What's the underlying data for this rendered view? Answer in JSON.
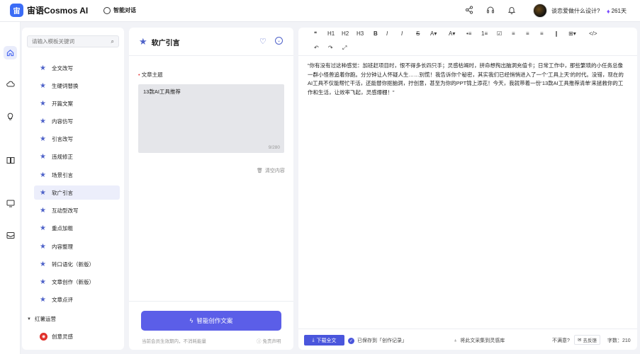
{
  "app": {
    "logo_glyph": "宙",
    "name": "宙语Cosmos AI"
  },
  "header": {
    "nav_chat": "智能对话",
    "icons": [
      "share-icon",
      "headset-icon",
      "bell-icon"
    ],
    "user_name": "谈恋爱做什么设计?",
    "vip_days": "261天"
  },
  "rail": {
    "items": [
      "home-icon",
      "cloud-icon",
      "bulb-icon",
      "book-icon",
      "monitor-icon",
      "mail-icon"
    ],
    "active_index": 0
  },
  "templates": {
    "search_placeholder": "请输入模板关键词",
    "items": [
      "全文改写",
      "生硬词替换",
      "开篇文案",
      "内容仿写",
      "引言改写",
      "违规修正",
      "场景引言",
      "软广引言",
      "互动型改写",
      "重点加粗",
      "内容整理",
      "转口语化（新版）",
      "文章创作（新版）",
      "文章点评"
    ],
    "active": "软广引言",
    "group": "红薯运营",
    "group_items": [
      "创意灵感"
    ]
  },
  "form": {
    "title": "软广引言",
    "field_label": "文章主题",
    "field_value": "13款AI工具推荐",
    "char_count": "9/280",
    "clear_label": "清空内容",
    "generate_label": "智能创作文案",
    "foot_note": "当前会员生效期内，不消耗能量",
    "disclaimer": "免责声明"
  },
  "editor": {
    "toolbar": [
      "❝",
      "H1",
      "H2",
      "H3",
      "B",
      "I",
      "I",
      "S",
      "A▾",
      "A▾",
      "•≡",
      "1≡",
      "☑",
      "≡",
      "≡",
      "≡",
      "∥",
      "⊞▾",
      "</>",
      "↶",
      "↷",
      "⤢"
    ],
    "content": "“你有没有过这种感觉：加班赶项目时，恨不得多长四只手；灵感枯竭时，拼命想掏出脑洞充值卡；日常工作中，那些繁琐的小任务总像一群小怪兽追着你跑。分分钟让人怀疑人生……别慌！我告诉你个秘密，其实我们已经悄悄进入了一个‘工具上天’的时代。没错，现在的AI工具不仅能帮忙干活，还能替你抠脑洞，拧创意，甚至为你的PPT锦上添花！今天，我就带着一份‘13款AI工具推荐清单’来拯救你的工作和生活，让效率飞起，灵感爆棚！”",
    "download_label": "下载全文",
    "saved_label": "已保存到「创作记录」",
    "collect_label": "将此文采集到灵感库",
    "unsat_label": "不满意?",
    "feedback_label": "去反馈",
    "word_count": "字数：210"
  }
}
